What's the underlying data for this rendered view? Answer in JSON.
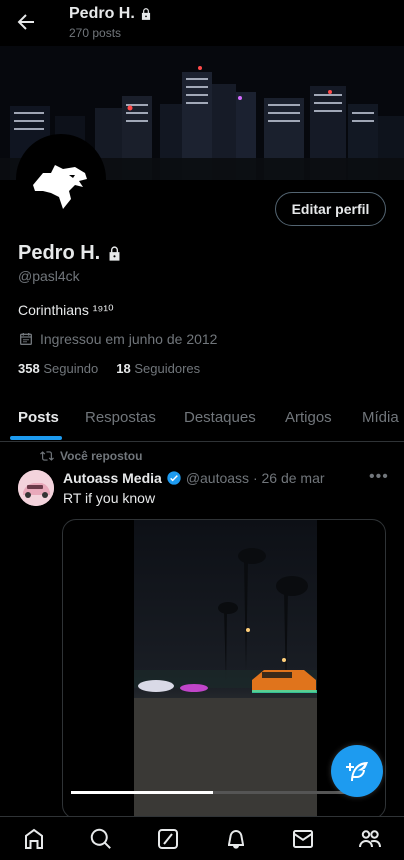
{
  "header": {
    "name": "Pedro H.",
    "posts_count": "270 posts"
  },
  "profile": {
    "edit_label": "Editar perfil",
    "name": "Pedro H.",
    "handle": "@pasl4ck",
    "bio": "Corinthians ¹⁹¹⁰",
    "joined": "Ingressou em junho de 2012",
    "following_count": "358",
    "following_label": "Seguindo",
    "followers_count": "18",
    "followers_label": "Seguidores"
  },
  "tabs": [
    {
      "label": "Posts"
    },
    {
      "label": "Respostas"
    },
    {
      "label": "Destaques"
    },
    {
      "label": "Artigos"
    },
    {
      "label": "Mídia"
    }
  ],
  "post": {
    "repost_label": "Você repostou",
    "author": "Autoass Media",
    "meta": "@autoass · 26 de mar",
    "text": "RT if you know",
    "video_progress": 0.49
  },
  "icons": {
    "back": "arrow-left-icon",
    "lock": "lock-icon",
    "calendar": "calendar-icon",
    "repost": "repost-icon",
    "verified": "verified-badge-icon",
    "compose": "compose-icon",
    "nav": [
      "home-icon",
      "search-icon",
      "grok-icon",
      "notifications-icon",
      "messages-icon",
      "communities-icon"
    ]
  },
  "colors": {
    "accent": "#1d9bf0",
    "background": "#000000",
    "text": "#e7e9ea",
    "muted": "#71767b"
  }
}
